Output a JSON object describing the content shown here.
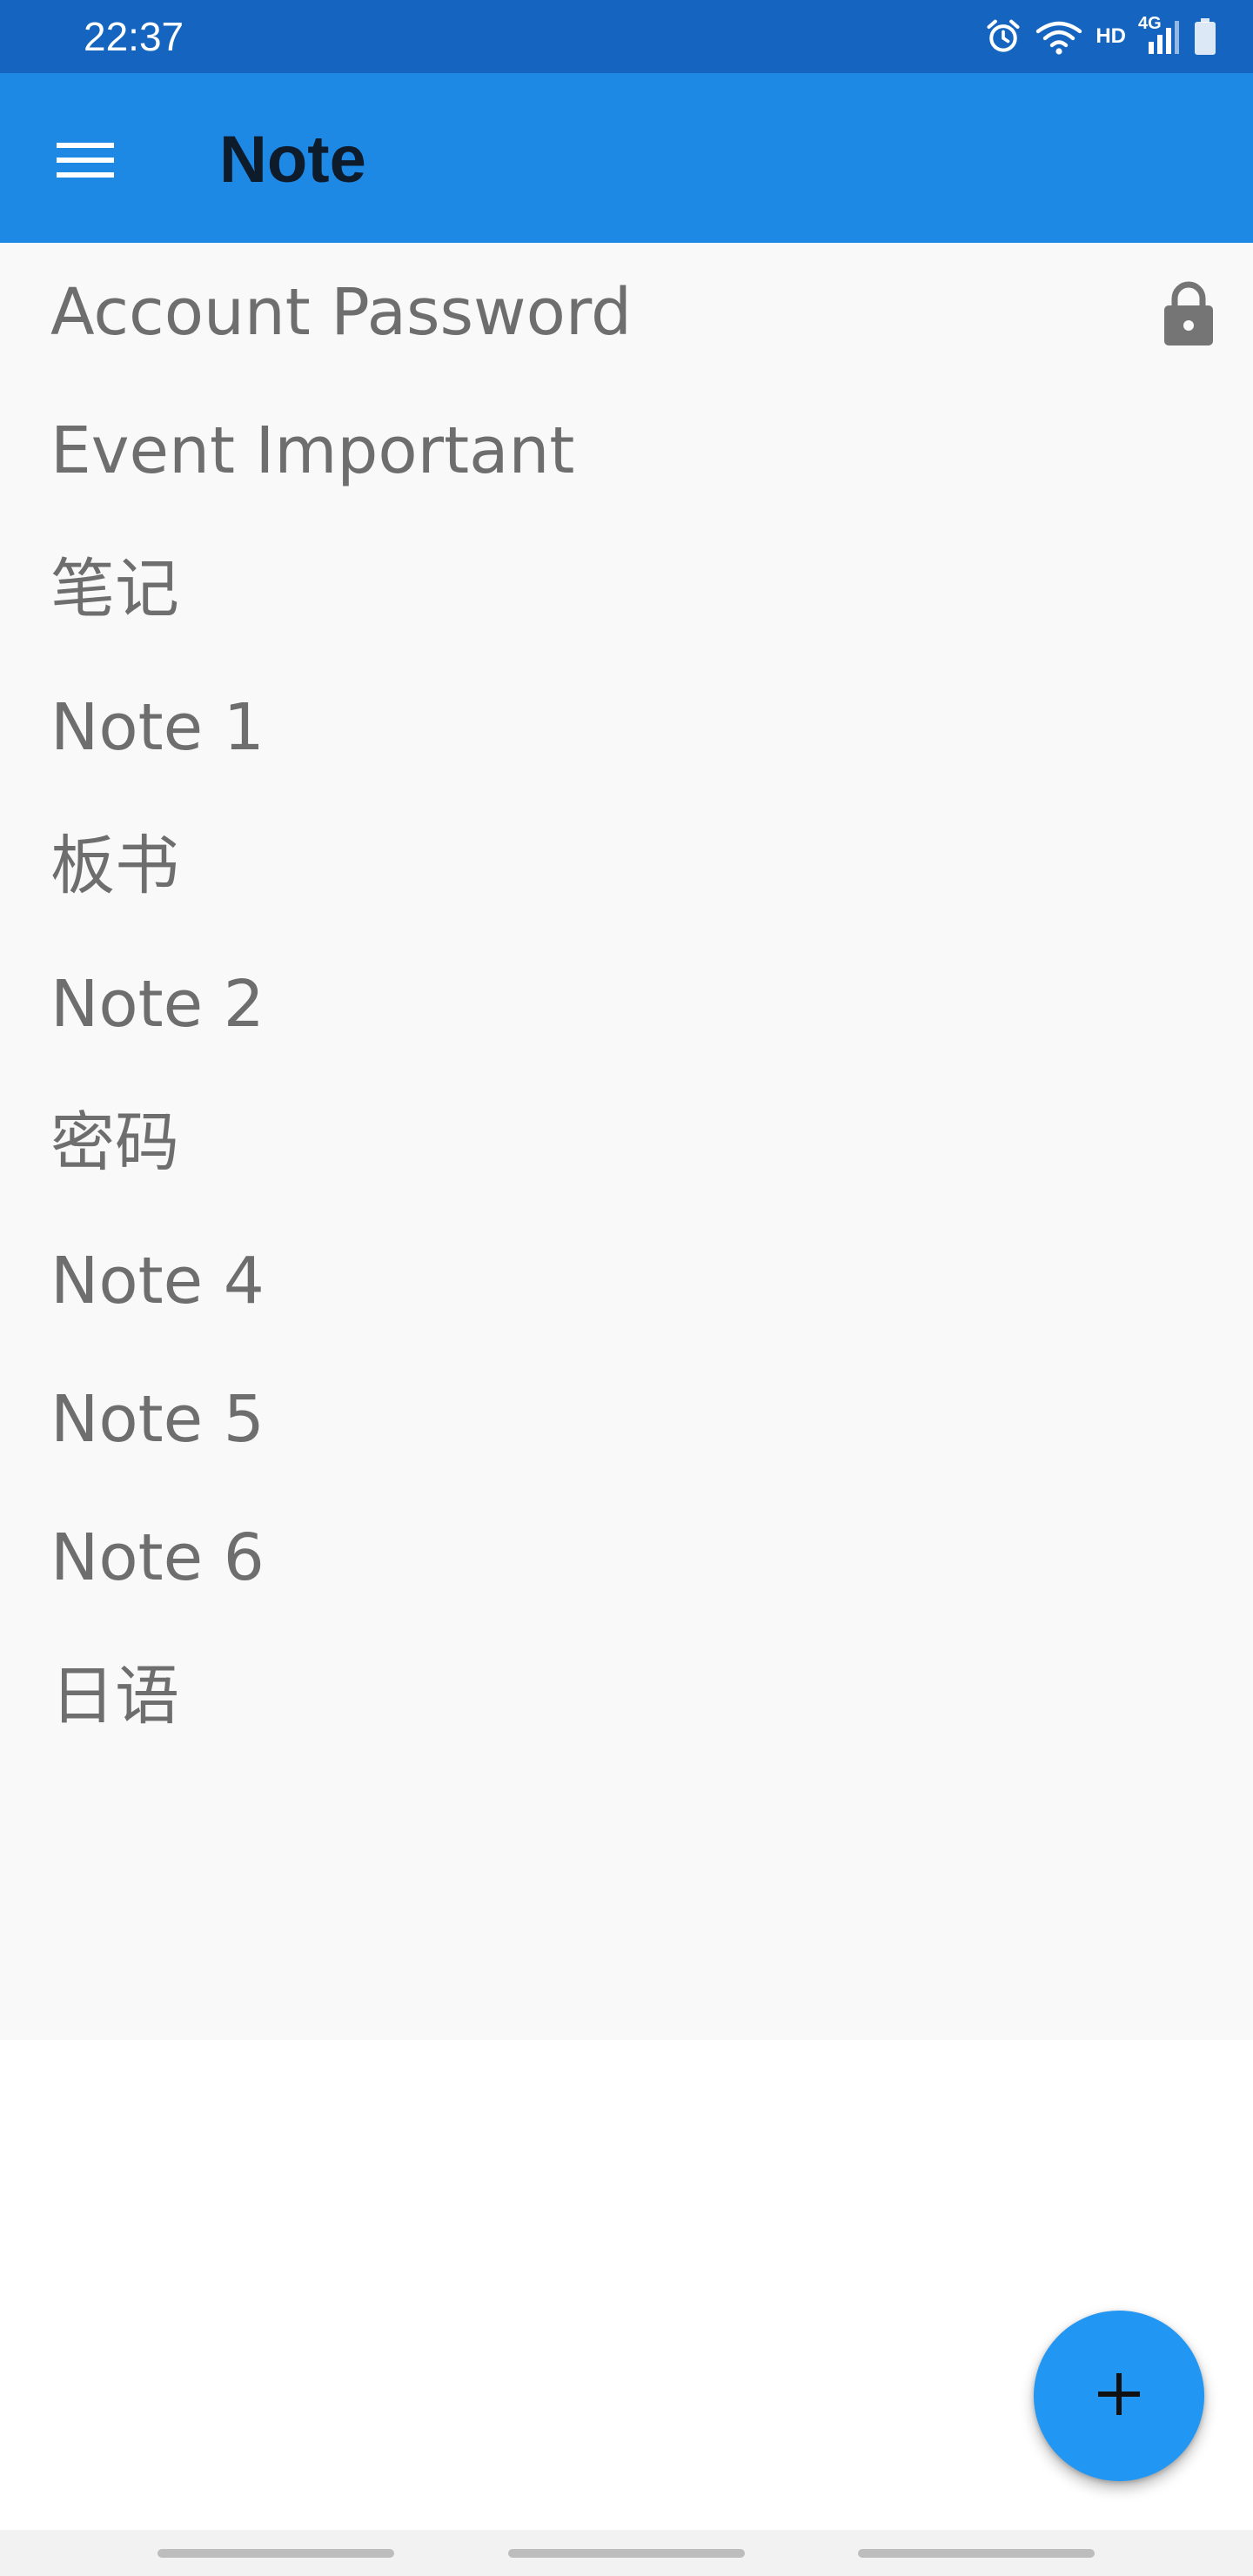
{
  "status_bar": {
    "time": "22:37",
    "network_label": "HD",
    "network_type": "4G",
    "icons": [
      "alarm-icon",
      "wifi-icon",
      "signal-icon",
      "battery-icon"
    ]
  },
  "app_bar": {
    "title": "Note",
    "menu_icon": "hamburger-menu-icon"
  },
  "notes": [
    {
      "title": "Account Password",
      "locked": true
    },
    {
      "title": "Event Important",
      "locked": false
    },
    {
      "title": "笔记",
      "locked": false
    },
    {
      "title": "Note 1",
      "locked": false
    },
    {
      "title": "板书",
      "locked": false
    },
    {
      "title": "Note 2",
      "locked": false
    },
    {
      "title": "密码",
      "locked": false
    },
    {
      "title": "Note 4",
      "locked": false
    },
    {
      "title": "Note 5",
      "locked": false
    },
    {
      "title": "Note 6",
      "locked": false
    },
    {
      "title": "日语",
      "locked": false
    }
  ],
  "fab": {
    "icon": "plus-icon"
  },
  "colors": {
    "status_bar": "#1565C0",
    "app_bar": "#1E88E5",
    "fab": "#2196F3",
    "list_background": "#F9F9F9",
    "note_text": "#6E6E6E"
  }
}
